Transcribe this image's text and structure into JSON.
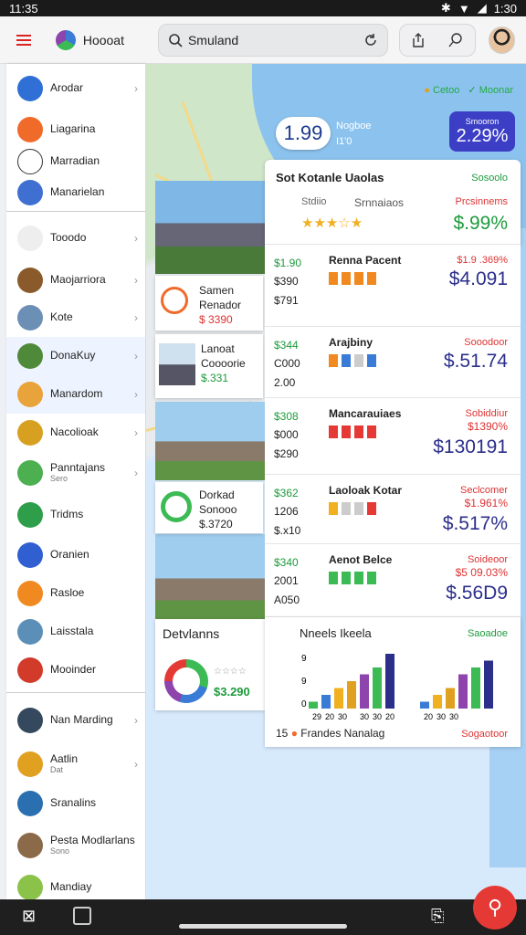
{
  "status": {
    "time": "11:35",
    "right_time": "1:30"
  },
  "header": {
    "title": "Hoooat",
    "search_value": "Smuland"
  },
  "sidebar": {
    "items": [
      {
        "label": "Arodar",
        "chevron": true,
        "color": "#2f6fd6"
      },
      {
        "label": "Liagarina",
        "chevron": false,
        "color": "#f06a2a"
      },
      {
        "label": "Marradian",
        "chevron": false,
        "color": "#ffffff"
      },
      {
        "label": "Manarielan",
        "chevron": false,
        "color": "#3f6fd0"
      },
      {
        "label": "Tooodo",
        "chevron": true,
        "color": "#eeeeee"
      },
      {
        "label": "Maojarriora",
        "chevron": true,
        "color": "#8b5a2b"
      },
      {
        "label": "Kote",
        "chevron": true,
        "color": "#6b8fb5"
      },
      {
        "label": "DonaKuy",
        "chevron": true,
        "color": "#4f8a3a"
      },
      {
        "label": "Manardom",
        "chevron": true,
        "color": "#e8a33a"
      },
      {
        "label": "Nacolioak",
        "chevron": true,
        "color": "#d8a020"
      },
      {
        "label": "Panntajans",
        "sub": "Sero",
        "chevron": true,
        "color": "#4caf50"
      },
      {
        "label": "Tridms",
        "chevron": false,
        "color": "#2e9e4a"
      },
      {
        "label": "Oranien",
        "chevron": false,
        "color": "#2f5fd0"
      },
      {
        "label": "Rasloe",
        "chevron": false,
        "color": "#f08a20"
      },
      {
        "label": "Laisstala",
        "chevron": false,
        "color": "#5b8fb8"
      },
      {
        "label": "Mooinder",
        "chevron": false,
        "color": "#d23a2a"
      },
      {
        "label": "Nan Marding",
        "chevron": true,
        "color": "#34495e"
      },
      {
        "label": "Aatlin",
        "sub": "Dat",
        "chevron": true,
        "color": "#e0a020"
      },
      {
        "label": "Sranalins",
        "chevron": false,
        "color": "#2a6fb0"
      },
      {
        "label": "Pesta Modlarlans",
        "sub": "Sono",
        "chevron": false,
        "color": "#8b6a4a"
      },
      {
        "label": "Mandiay",
        "chevron": false,
        "color": "#8bc34a"
      }
    ]
  },
  "map": {
    "legend_left": "Cetoo",
    "legend_right": "Moonar",
    "pill_value": "1.99",
    "pill_label": "Nogboe",
    "pill_sub": "I1'0",
    "bluebox_sub": "Smooron",
    "bluebox_value": "2.29%"
  },
  "left_cards": [
    {
      "title": "Samen",
      "sub": "Renador",
      "price": "$ 3390"
    },
    {
      "title": "Lanoat",
      "sub": "Coooorie",
      "price": "$.331"
    },
    {
      "title": "Dorkad",
      "sub": "Sonooo",
      "price": "$.3720"
    },
    {
      "title": "Detvlanns",
      "price": "$3.290"
    }
  ],
  "list": {
    "header": {
      "title": "Sot Kotanle Uaolas",
      "right": "Sosoolo"
    },
    "rows": [
      {
        "l1": "Stdiio",
        "title": "Srnnaiaos",
        "rlabel": "Prcsinnems",
        "rvalue": "$.99%",
        "rcolor": "green",
        "stars": "★★★☆★"
      },
      {
        "l1": "$1.90",
        "l2": "$390",
        "l3": "$791",
        "title": "Renna Pacent",
        "rlabel": "$1.9 .369%",
        "rvalue": "$4.091",
        "rcolor": "navy"
      },
      {
        "l1": "$344",
        "l2": "C000",
        "l3": "2.00",
        "title": "Arajbiny",
        "rlabel": "Sooodoor",
        "rvalue": "$.51.74",
        "rcolor": "navy"
      },
      {
        "l1": "$308",
        "l2": "$000",
        "l3": "$290",
        "title": "Mancarauiaes",
        "rlabel": "Sobiddiur",
        "rvalue": "$130191",
        "rcolor": "navy",
        "mid": "$1390%"
      },
      {
        "l1": "$362",
        "l2": "1206",
        "l3": "$.x10",
        "title": "Laoloak Kotar",
        "rlabel": "Seclcomer",
        "rvalue": "$.517%",
        "rcolor": "navy",
        "mid": "$1.961%"
      },
      {
        "l1": "$340",
        "l2": "2001",
        "l3": "A050",
        "title": "Aenot Belce",
        "rlabel": "Soideoor",
        "rvalue": "$.56D9",
        "rcolor": "navy",
        "mid": "$5 09.03%"
      }
    ]
  },
  "chart": {
    "title": "Nneels Ikeela",
    "right": "Saoadoe",
    "ylabels": [
      "9",
      "9",
      "0"
    ],
    "xlabels": [
      "29",
      "20",
      "30",
      "30",
      "30",
      "20",
      "20",
      "30",
      "30"
    ],
    "footer": "Frandes Nanalag",
    "footer_left": "15",
    "footer_right": "Sogaotoor",
    "chart_data": {
      "type": "bar",
      "series": [
        {
          "values": [
            1,
            2,
            3,
            4,
            5,
            6,
            8
          ]
        },
        {
          "values": [
            1,
            2,
            3,
            5,
            6,
            7
          ]
        }
      ]
    }
  }
}
